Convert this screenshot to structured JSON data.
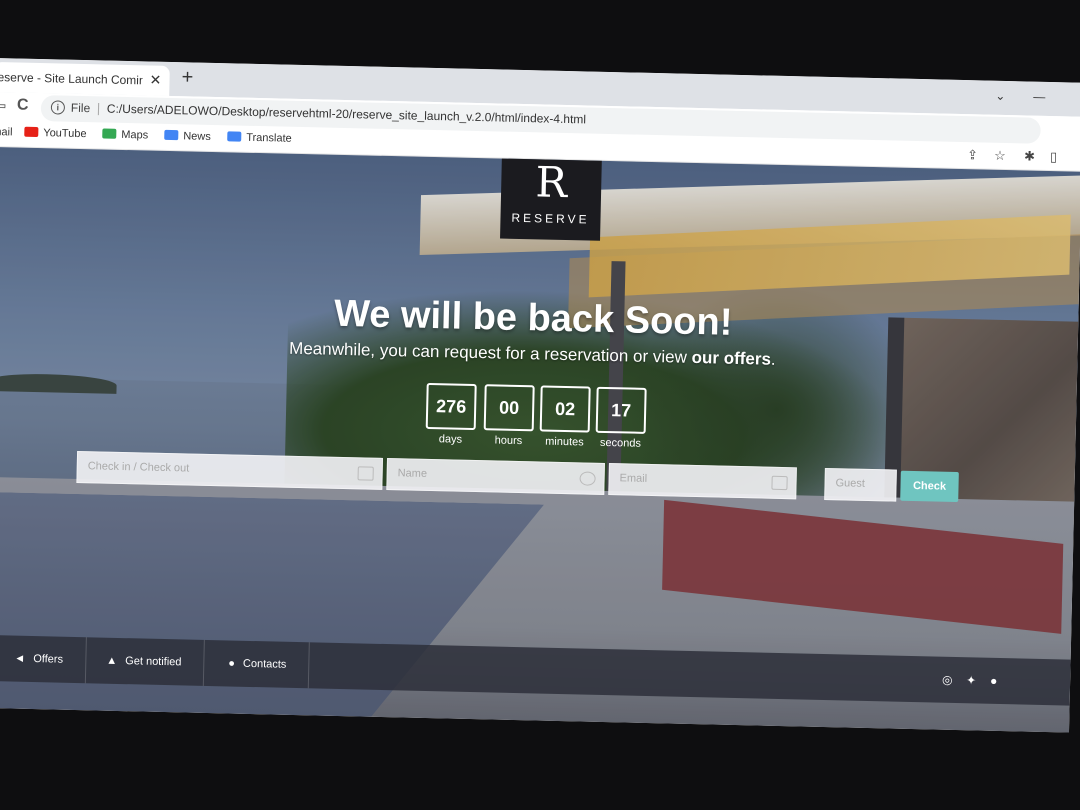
{
  "browser": {
    "tab_title": "eserve - Site Launch Coming so",
    "tab_close": "✕",
    "new_tab": "+",
    "window_controls": [
      "⌄",
      "—"
    ],
    "back": "⇦",
    "reload": "C",
    "info": "i",
    "file_label": "File",
    "url_separator": "|",
    "url": "C:/Users/ADELOWO/Desktop/reservehtml-20/reserve_site_launch_v.2.0/html/index-4.html",
    "toolbar_icons": [
      "⇪",
      "☆",
      "✱",
      "▯"
    ]
  },
  "bookmarks": [
    {
      "label": "mail",
      "icon_color": ""
    },
    {
      "label": "YouTube",
      "icon_color": "#e62117"
    },
    {
      "label": "Maps",
      "icon_color": "#34a853"
    },
    {
      "label": "News",
      "icon_color": "#4285f4"
    },
    {
      "label": "Translate",
      "icon_color": "#4285f4"
    }
  ],
  "page": {
    "logo_letter": "R",
    "logo_text": "RESERVE",
    "headline": "We will be back Soon!",
    "subline_start": "Meanwhile, you can request for a reservation or view ",
    "subline_link": "our offers",
    "subline_end": ".",
    "countdown": [
      {
        "value": "276",
        "label": "days"
      },
      {
        "value": "00",
        "label": "hours"
      },
      {
        "value": "02",
        "label": "minutes"
      },
      {
        "value": "17",
        "label": "seconds"
      }
    ],
    "booking": {
      "checkin_placeholder": "Check in / Check out",
      "name_placeholder": "Name",
      "email_placeholder": "Email",
      "guest_placeholder": "Guest",
      "check_label": "Check"
    },
    "footer": {
      "offers": "Offers",
      "get_notified": "Get notified",
      "contacts": "Contacts"
    },
    "social_icons": [
      "instagram-icon",
      "twitter-icon",
      "facebook-icon"
    ]
  },
  "colors": {
    "check_button": "#6fc5c0",
    "logo_bg": "#1b1b1f"
  }
}
